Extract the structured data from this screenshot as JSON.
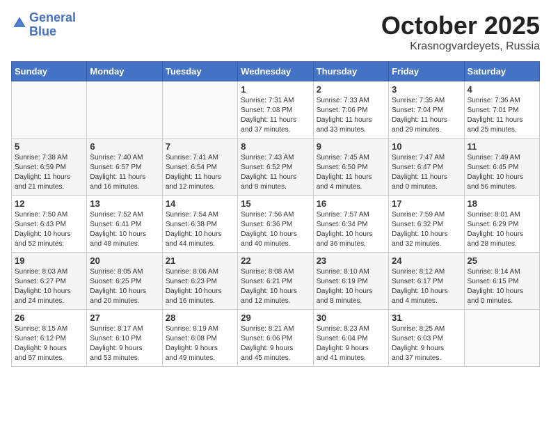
{
  "header": {
    "logo_line1": "General",
    "logo_line2": "Blue",
    "month_title": "October 2025",
    "location": "Krasnogvardeyets, Russia"
  },
  "days_of_week": [
    "Sunday",
    "Monday",
    "Tuesday",
    "Wednesday",
    "Thursday",
    "Friday",
    "Saturday"
  ],
  "weeks": [
    [
      {
        "day": "",
        "info": ""
      },
      {
        "day": "",
        "info": ""
      },
      {
        "day": "",
        "info": ""
      },
      {
        "day": "1",
        "info": "Sunrise: 7:31 AM\nSunset: 7:08 PM\nDaylight: 11 hours\nand 37 minutes."
      },
      {
        "day": "2",
        "info": "Sunrise: 7:33 AM\nSunset: 7:06 PM\nDaylight: 11 hours\nand 33 minutes."
      },
      {
        "day": "3",
        "info": "Sunrise: 7:35 AM\nSunset: 7:04 PM\nDaylight: 11 hours\nand 29 minutes."
      },
      {
        "day": "4",
        "info": "Sunrise: 7:36 AM\nSunset: 7:01 PM\nDaylight: 11 hours\nand 25 minutes."
      }
    ],
    [
      {
        "day": "5",
        "info": "Sunrise: 7:38 AM\nSunset: 6:59 PM\nDaylight: 11 hours\nand 21 minutes."
      },
      {
        "day": "6",
        "info": "Sunrise: 7:40 AM\nSunset: 6:57 PM\nDaylight: 11 hours\nand 16 minutes."
      },
      {
        "day": "7",
        "info": "Sunrise: 7:41 AM\nSunset: 6:54 PM\nDaylight: 11 hours\nand 12 minutes."
      },
      {
        "day": "8",
        "info": "Sunrise: 7:43 AM\nSunset: 6:52 PM\nDaylight: 11 hours\nand 8 minutes."
      },
      {
        "day": "9",
        "info": "Sunrise: 7:45 AM\nSunset: 6:50 PM\nDaylight: 11 hours\nand 4 minutes."
      },
      {
        "day": "10",
        "info": "Sunrise: 7:47 AM\nSunset: 6:47 PM\nDaylight: 11 hours\nand 0 minutes."
      },
      {
        "day": "11",
        "info": "Sunrise: 7:49 AM\nSunset: 6:45 PM\nDaylight: 10 hours\nand 56 minutes."
      }
    ],
    [
      {
        "day": "12",
        "info": "Sunrise: 7:50 AM\nSunset: 6:43 PM\nDaylight: 10 hours\nand 52 minutes."
      },
      {
        "day": "13",
        "info": "Sunrise: 7:52 AM\nSunset: 6:41 PM\nDaylight: 10 hours\nand 48 minutes."
      },
      {
        "day": "14",
        "info": "Sunrise: 7:54 AM\nSunset: 6:38 PM\nDaylight: 10 hours\nand 44 minutes."
      },
      {
        "day": "15",
        "info": "Sunrise: 7:56 AM\nSunset: 6:36 PM\nDaylight: 10 hours\nand 40 minutes."
      },
      {
        "day": "16",
        "info": "Sunrise: 7:57 AM\nSunset: 6:34 PM\nDaylight: 10 hours\nand 36 minutes."
      },
      {
        "day": "17",
        "info": "Sunrise: 7:59 AM\nSunset: 6:32 PM\nDaylight: 10 hours\nand 32 minutes."
      },
      {
        "day": "18",
        "info": "Sunrise: 8:01 AM\nSunset: 6:29 PM\nDaylight: 10 hours\nand 28 minutes."
      }
    ],
    [
      {
        "day": "19",
        "info": "Sunrise: 8:03 AM\nSunset: 6:27 PM\nDaylight: 10 hours\nand 24 minutes."
      },
      {
        "day": "20",
        "info": "Sunrise: 8:05 AM\nSunset: 6:25 PM\nDaylight: 10 hours\nand 20 minutes."
      },
      {
        "day": "21",
        "info": "Sunrise: 8:06 AM\nSunset: 6:23 PM\nDaylight: 10 hours\nand 16 minutes."
      },
      {
        "day": "22",
        "info": "Sunrise: 8:08 AM\nSunset: 6:21 PM\nDaylight: 10 hours\nand 12 minutes."
      },
      {
        "day": "23",
        "info": "Sunrise: 8:10 AM\nSunset: 6:19 PM\nDaylight: 10 hours\nand 8 minutes."
      },
      {
        "day": "24",
        "info": "Sunrise: 8:12 AM\nSunset: 6:17 PM\nDaylight: 10 hours\nand 4 minutes."
      },
      {
        "day": "25",
        "info": "Sunrise: 8:14 AM\nSunset: 6:15 PM\nDaylight: 10 hours\nand 0 minutes."
      }
    ],
    [
      {
        "day": "26",
        "info": "Sunrise: 8:15 AM\nSunset: 6:12 PM\nDaylight: 9 hours\nand 57 minutes."
      },
      {
        "day": "27",
        "info": "Sunrise: 8:17 AM\nSunset: 6:10 PM\nDaylight: 9 hours\nand 53 minutes."
      },
      {
        "day": "28",
        "info": "Sunrise: 8:19 AM\nSunset: 6:08 PM\nDaylight: 9 hours\nand 49 minutes."
      },
      {
        "day": "29",
        "info": "Sunrise: 8:21 AM\nSunset: 6:06 PM\nDaylight: 9 hours\nand 45 minutes."
      },
      {
        "day": "30",
        "info": "Sunrise: 8:23 AM\nSunset: 6:04 PM\nDaylight: 9 hours\nand 41 minutes."
      },
      {
        "day": "31",
        "info": "Sunrise: 8:25 AM\nSunset: 6:03 PM\nDaylight: 9 hours\nand 37 minutes."
      },
      {
        "day": "",
        "info": ""
      }
    ]
  ]
}
